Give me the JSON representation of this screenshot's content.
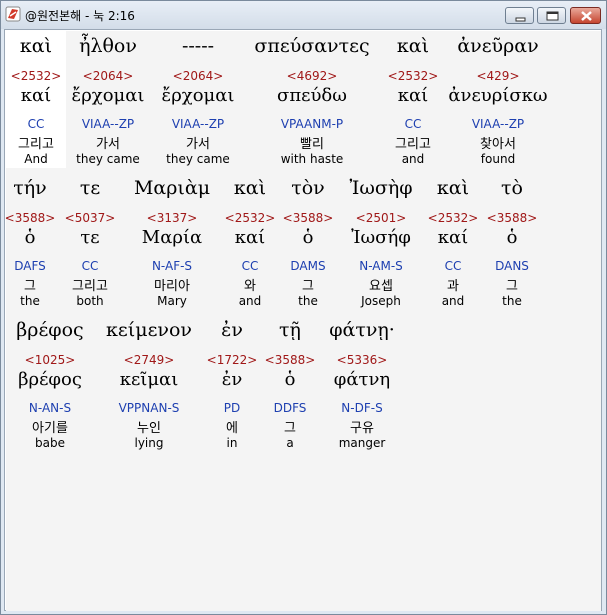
{
  "window": {
    "title": "@원전본해 - 눅 2:16",
    "controls": {
      "minimize": "minimize-icon",
      "maximize": "maximize-icon",
      "close": "close-icon"
    }
  },
  "rows": [
    {
      "words": [
        {
          "greek": "καὶ",
          "strong": "<2532>",
          "lemma": "καί",
          "morph": "CC",
          "korean": "그리고",
          "english": "And"
        },
        {
          "greek": "ἦλθον",
          "strong": "<2064>",
          "lemma": "ἔρχομαι",
          "morph": "VIAA--ZP",
          "korean": "가서",
          "english": "they came"
        },
        {
          "greek": "-----",
          "strong": "<2064>",
          "lemma": "ἔρχομαι",
          "morph": "VIAA--ZP",
          "korean": "가서",
          "english": "they came"
        },
        {
          "greek": "σπεύσαντες",
          "strong": "<4692>",
          "lemma": "σπεύδω",
          "morph": "VPAANM-P",
          "korean": "빨리",
          "english": "with haste"
        },
        {
          "greek": "καὶ",
          "strong": "<2532>",
          "lemma": "καί",
          "morph": "CC",
          "korean": "그리고",
          "english": "and"
        },
        {
          "greek": "ἀνεῦραν",
          "strong": "<429>",
          "lemma": "ἀνευρίσκω",
          "morph": "VIAA--ZP",
          "korean": "찾아서",
          "english": "found"
        }
      ]
    },
    {
      "words": [
        {
          "greek": "τήν",
          "strong": "<3588>",
          "lemma": "ὁ",
          "morph": "DAFS",
          "korean": "그",
          "english": "the"
        },
        {
          "greek": "τε",
          "strong": "<5037>",
          "lemma": "τε",
          "morph": "CC",
          "korean": "그리고",
          "english": "both"
        },
        {
          "greek": "Μαριὰμ",
          "strong": "<3137>",
          "lemma": "Μαρία",
          "morph": "N-AF-S",
          "korean": "마리아",
          "english": "Mary"
        },
        {
          "greek": "καὶ",
          "strong": "<2532>",
          "lemma": "καί",
          "morph": "CC",
          "korean": "와",
          "english": "and"
        },
        {
          "greek": "τὸν",
          "strong": "<3588>",
          "lemma": "ὁ",
          "morph": "DAMS",
          "korean": "그",
          "english": "the"
        },
        {
          "greek": "Ἰωσὴφ",
          "strong": "<2501>",
          "lemma": "Ἰωσήφ",
          "morph": "N-AM-S",
          "korean": "요셉",
          "english": "Joseph"
        },
        {
          "greek": "καὶ",
          "strong": "<2532>",
          "lemma": "καί",
          "morph": "CC",
          "korean": "과",
          "english": "and"
        },
        {
          "greek": "τὸ",
          "strong": "<3588>",
          "lemma": "ὁ",
          "morph": "DANS",
          "korean": "그",
          "english": "the"
        }
      ]
    },
    {
      "words": [
        {
          "greek": "βρέφος",
          "strong": "<1025>",
          "lemma": "βρέφος",
          "morph": "N-AN-S",
          "korean": "아기를",
          "english": "babe"
        },
        {
          "greek": "κείμενον",
          "strong": "<2749>",
          "lemma": "κεῖμαι",
          "morph": "VPPNAN-S",
          "korean": "누인",
          "english": "lying"
        },
        {
          "greek": "ἐν",
          "strong": "<1722>",
          "lemma": "ἐν",
          "morph": "PD",
          "korean": "에",
          "english": "in"
        },
        {
          "greek": "τῇ",
          "strong": "<3588>",
          "lemma": "ὁ",
          "morph": "DDFS",
          "korean": "그",
          "english": "a"
        },
        {
          "greek": "φάτνῃ·",
          "strong": "<5336>",
          "lemma": "φάτνη",
          "morph": "N-DF-S",
          "korean": "구유",
          "english": "manger"
        }
      ]
    }
  ]
}
